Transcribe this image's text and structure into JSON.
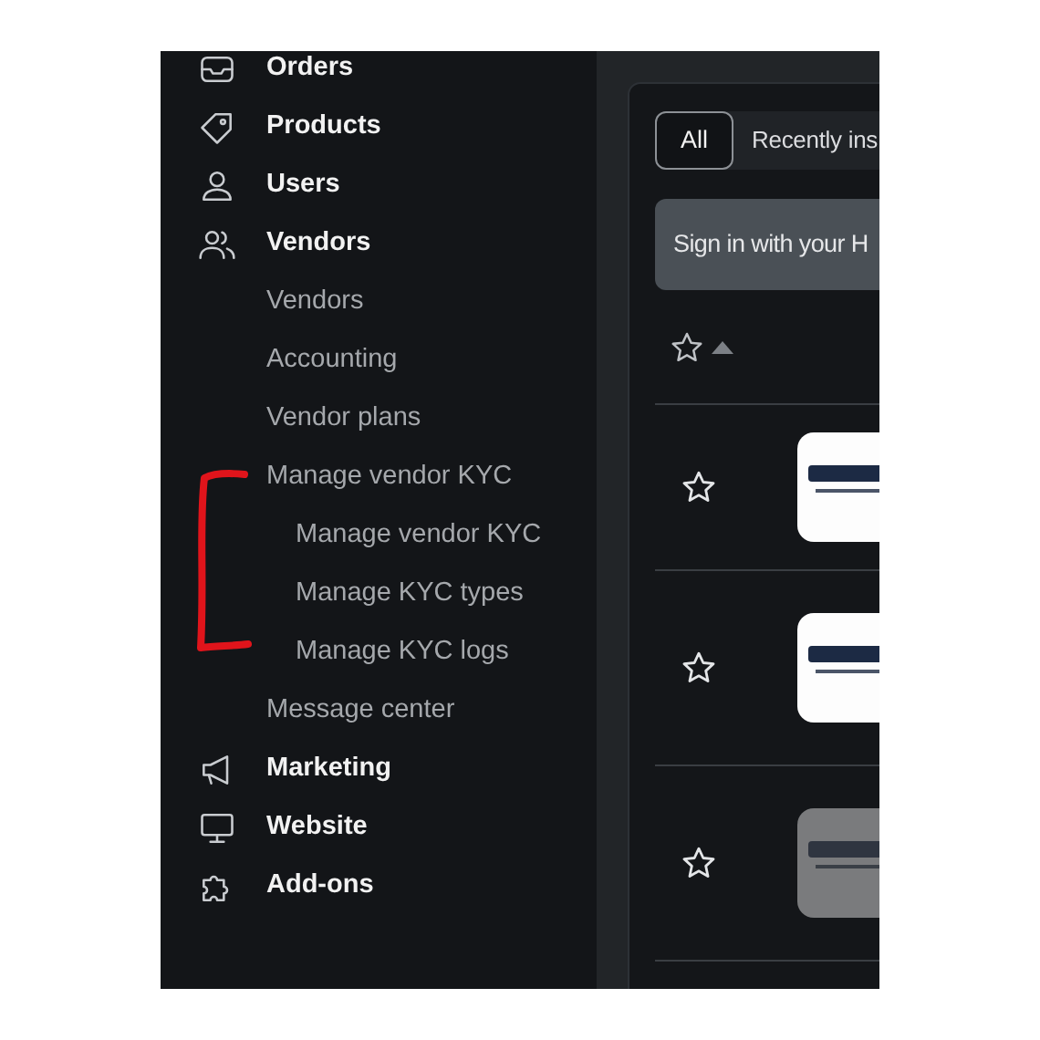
{
  "sidebar": {
    "items": [
      {
        "label": "Orders"
      },
      {
        "label": "Products"
      },
      {
        "label": "Users"
      },
      {
        "label": "Vendors",
        "children": [
          {
            "label": "Vendors"
          },
          {
            "label": "Accounting"
          },
          {
            "label": "Vendor plans"
          },
          {
            "label": "Manage vendor KYC",
            "children": [
              {
                "label": "Manage vendor KYC"
              },
              {
                "label": "Manage KYC types"
              },
              {
                "label": "Manage KYC logs"
              }
            ]
          },
          {
            "label": "Message center"
          }
        ]
      },
      {
        "label": "Marketing"
      },
      {
        "label": "Website"
      },
      {
        "label": "Add-ons"
      }
    ]
  },
  "tabs": [
    {
      "label": "All",
      "selected": true
    },
    {
      "label": "Recently ins",
      "selected": false
    }
  ],
  "alert": {
    "text": "Sign in with your H"
  },
  "table": {
    "rows": [
      {
        "starred": false,
        "disabled": false
      },
      {
        "starred": false,
        "disabled": false
      },
      {
        "starred": false,
        "disabled": true
      }
    ]
  }
}
